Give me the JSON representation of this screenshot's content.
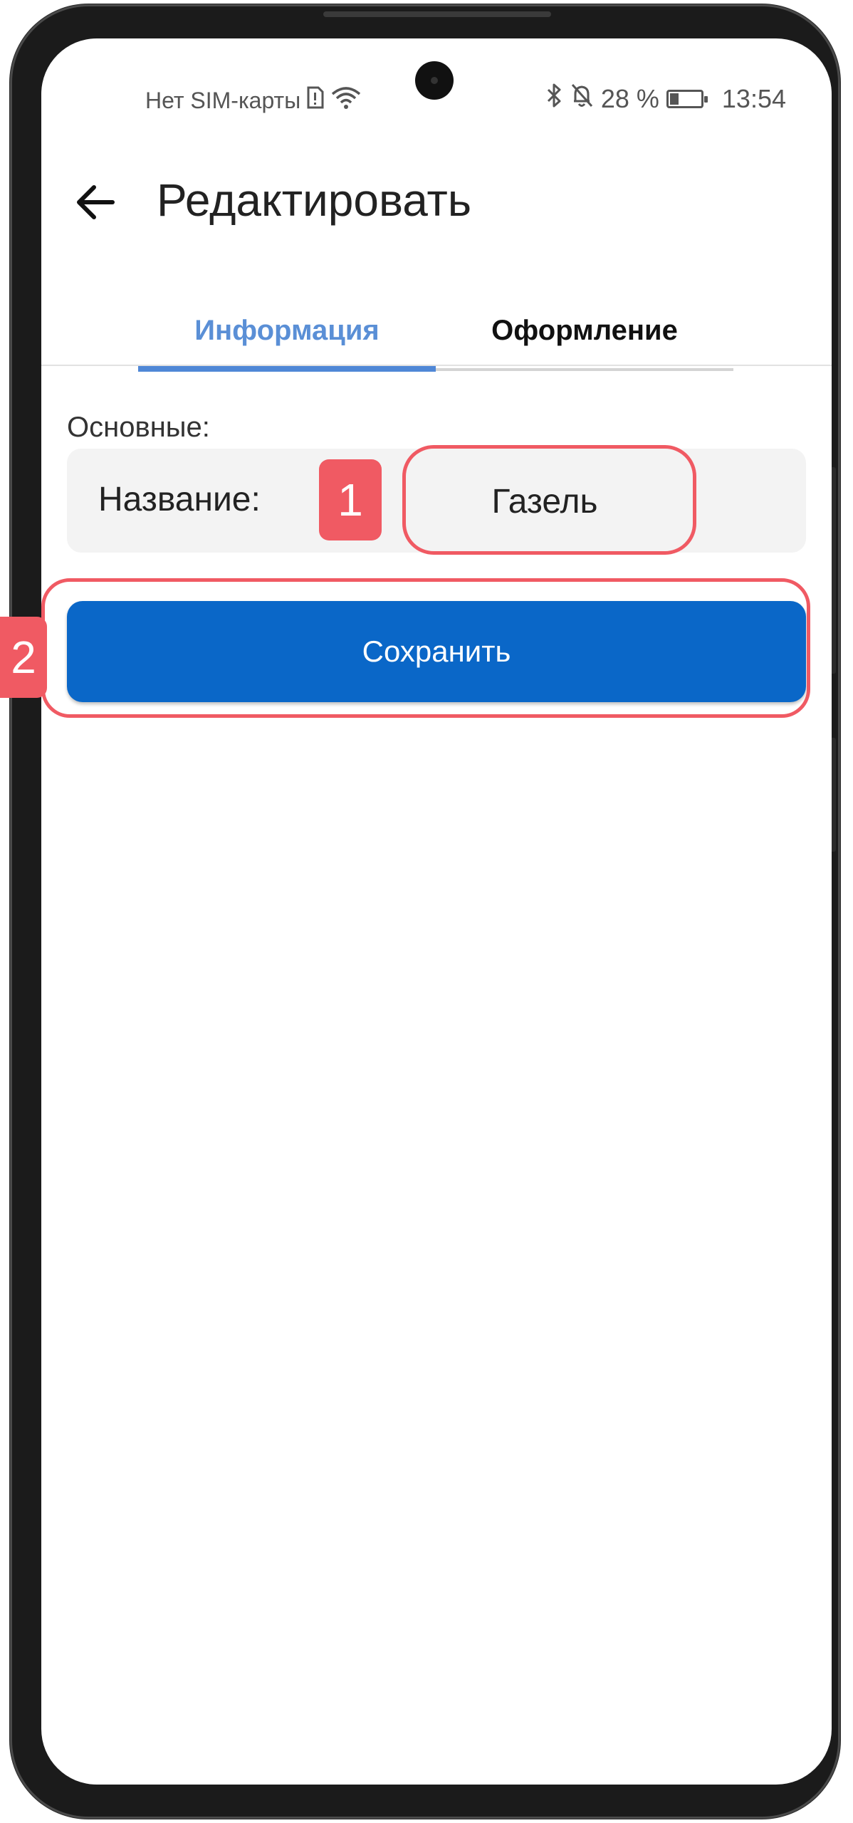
{
  "status_bar": {
    "carrier": "Нет SIM-карты",
    "battery_percent": "28 %",
    "time": "13:54",
    "icons": [
      "sim-alert-icon",
      "wifi-icon",
      "bluetooth-icon",
      "bell-off-icon",
      "battery-icon"
    ]
  },
  "header": {
    "back_icon": "arrow-left-icon",
    "title": "Редактировать"
  },
  "tabs": [
    {
      "label": "Информация",
      "active": true
    },
    {
      "label": "Оформление",
      "active": false
    }
  ],
  "section": {
    "label": "Основные:",
    "name_field": {
      "label": "Название:",
      "value": "Газель"
    }
  },
  "save_button": {
    "label": "Сохранить"
  },
  "annotations": [
    {
      "number": "1"
    },
    {
      "number": "2"
    }
  ],
  "colors": {
    "accent": "#0a67c8",
    "active_tab": "#5a8fd6",
    "highlight": "#f05a63"
  }
}
